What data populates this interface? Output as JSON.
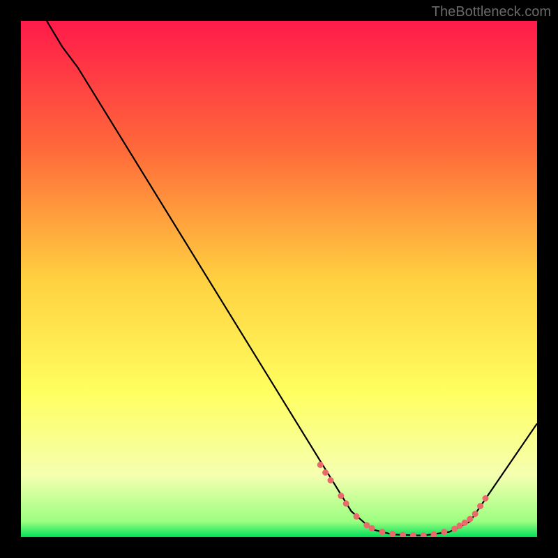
{
  "watermark": "TheBottleneck.com",
  "chart_data": {
    "type": "line",
    "title": "",
    "xlabel": "",
    "ylabel": "",
    "xlim": [
      0,
      100
    ],
    "ylim": [
      0,
      100
    ],
    "gradient_stops": [
      {
        "offset": 0,
        "color": "#ff1a4a"
      },
      {
        "offset": 25,
        "color": "#ff6a3a"
      },
      {
        "offset": 50,
        "color": "#ffd040"
      },
      {
        "offset": 72,
        "color": "#ffff60"
      },
      {
        "offset": 88,
        "color": "#f5ffb0"
      },
      {
        "offset": 97,
        "color": "#9bff80"
      },
      {
        "offset": 100,
        "color": "#00e05a"
      }
    ],
    "curve": [
      {
        "x": 5,
        "y": 100
      },
      {
        "x": 8,
        "y": 95
      },
      {
        "x": 11,
        "y": 91
      },
      {
        "x": 64,
        "y": 5
      },
      {
        "x": 68,
        "y": 1.5
      },
      {
        "x": 72,
        "y": 0.5
      },
      {
        "x": 78,
        "y": 0.3
      },
      {
        "x": 83,
        "y": 1
      },
      {
        "x": 87,
        "y": 3
      },
      {
        "x": 100,
        "y": 22
      }
    ],
    "dotted_region": [
      {
        "x": 58,
        "y": 14
      },
      {
        "x": 59,
        "y": 12.5
      },
      {
        "x": 60,
        "y": 11
      },
      {
        "x": 62,
        "y": 8
      },
      {
        "x": 63,
        "y": 6.5
      },
      {
        "x": 65,
        "y": 4
      },
      {
        "x": 67,
        "y": 2.3
      },
      {
        "x": 68,
        "y": 1.7
      },
      {
        "x": 70,
        "y": 1
      },
      {
        "x": 72,
        "y": 0.6
      },
      {
        "x": 74,
        "y": 0.4
      },
      {
        "x": 76,
        "y": 0.3
      },
      {
        "x": 78,
        "y": 0.3
      },
      {
        "x": 80,
        "y": 0.5
      },
      {
        "x": 82,
        "y": 1
      },
      {
        "x": 84,
        "y": 1.6
      },
      {
        "x": 85,
        "y": 2.2
      },
      {
        "x": 86,
        "y": 2.8
      },
      {
        "x": 87,
        "y": 3.5
      },
      {
        "x": 88,
        "y": 4.5
      },
      {
        "x": 89,
        "y": 6
      },
      {
        "x": 90,
        "y": 7.5
      }
    ],
    "dot_color": "#e86a6a"
  }
}
